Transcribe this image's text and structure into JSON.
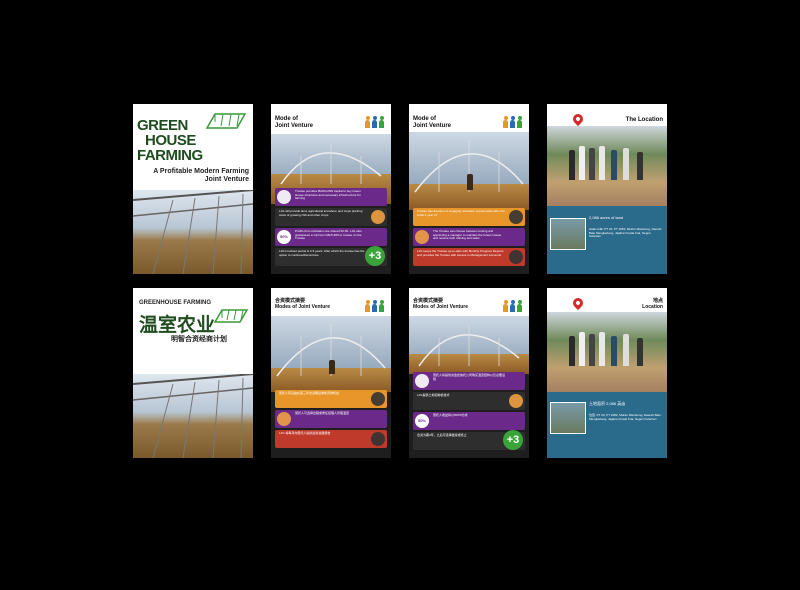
{
  "covers": {
    "en": {
      "title_line1": "GREEN",
      "title_line2": "HOUSE",
      "title_line3": "FARMING",
      "subtitle_line1": "A Profitable Modern Farming",
      "subtitle_line2": "Joint Venture"
    },
    "zh": {
      "label": "GREENHOUSE FARMING",
      "title": "温室农业",
      "subtitle": "明智合资经商计划"
    }
  },
  "mode_en": {
    "title_line1": "Mode of",
    "title_line2": "Joint Venture",
    "bands_a": [
      "Trustee provides BANGUNN capital to buy Green House structures and necessary infrastructure for farming",
      "LJG will provide land, agricultural knowhow, and crops planting costs of growing chili and other crops",
      "Profits from cultivation are shared 50-50. LJG also guarantees a minimum RETURN to trustee on the Trustee",
      "LJG's lockout period is 3-5 years. After which the trustee has the option to continue/discontinue"
    ],
    "pct": "50%",
    "plus": "+3",
    "bands_b": [
      "Trustee has freedom of engaging relocation opportunities after the initial 3 year JV",
      "The Trustee can choose between renting and appointing a manager to maintain the Green House and receive both training and sales",
      "LJG keeps the Trustee up-to-date with Monthly Progress Reports and provides the Trustee with access to Management Accounts"
    ]
  },
  "mode_zh": {
    "title_cn": "合资模式摘要",
    "title_en": "Modes of Joint Venture",
    "bands_a": [
      "受托人将提供资金给信托公司购买温室结构以及必要设施",
      "LJG提供土地和种植技术",
      "受托人收益将以50/50分成",
      "合资为期3年，之后可选择继续或终止"
    ],
    "pct": "50%",
    "plus": "+3",
    "bands_b": [
      "受托人有自由在首三年合资期后重新安排机会",
      "受托人可选择出租或委任经理人管理温室",
      "LJG 将每月向受托人提供最新进展报告"
    ]
  },
  "location_en": {
    "title": "The Location",
    "acres": "2,086 acres of land",
    "address": "Hakk milik: PT 20, PT 2082, Mukim Mambong, Daerah Batu Mengkebang, Jajahan Kuala Krai, Negeri Kelantan"
  },
  "location_zh": {
    "title_cn": "地点",
    "title_en": "Location",
    "acres": "土地面积 2,086 英亩",
    "address": "位置: PT 20, PT 2082, Mukim Mambong, Daerah Batu Mengkebang, Jajahan Kuala Krai, Negeri Kelantan"
  },
  "colors": {
    "green": "#2f8a3a",
    "orange": "#e8962a",
    "purple": "#6b2a8a",
    "red": "#c03a2b",
    "teal": "#2a8a8a"
  }
}
